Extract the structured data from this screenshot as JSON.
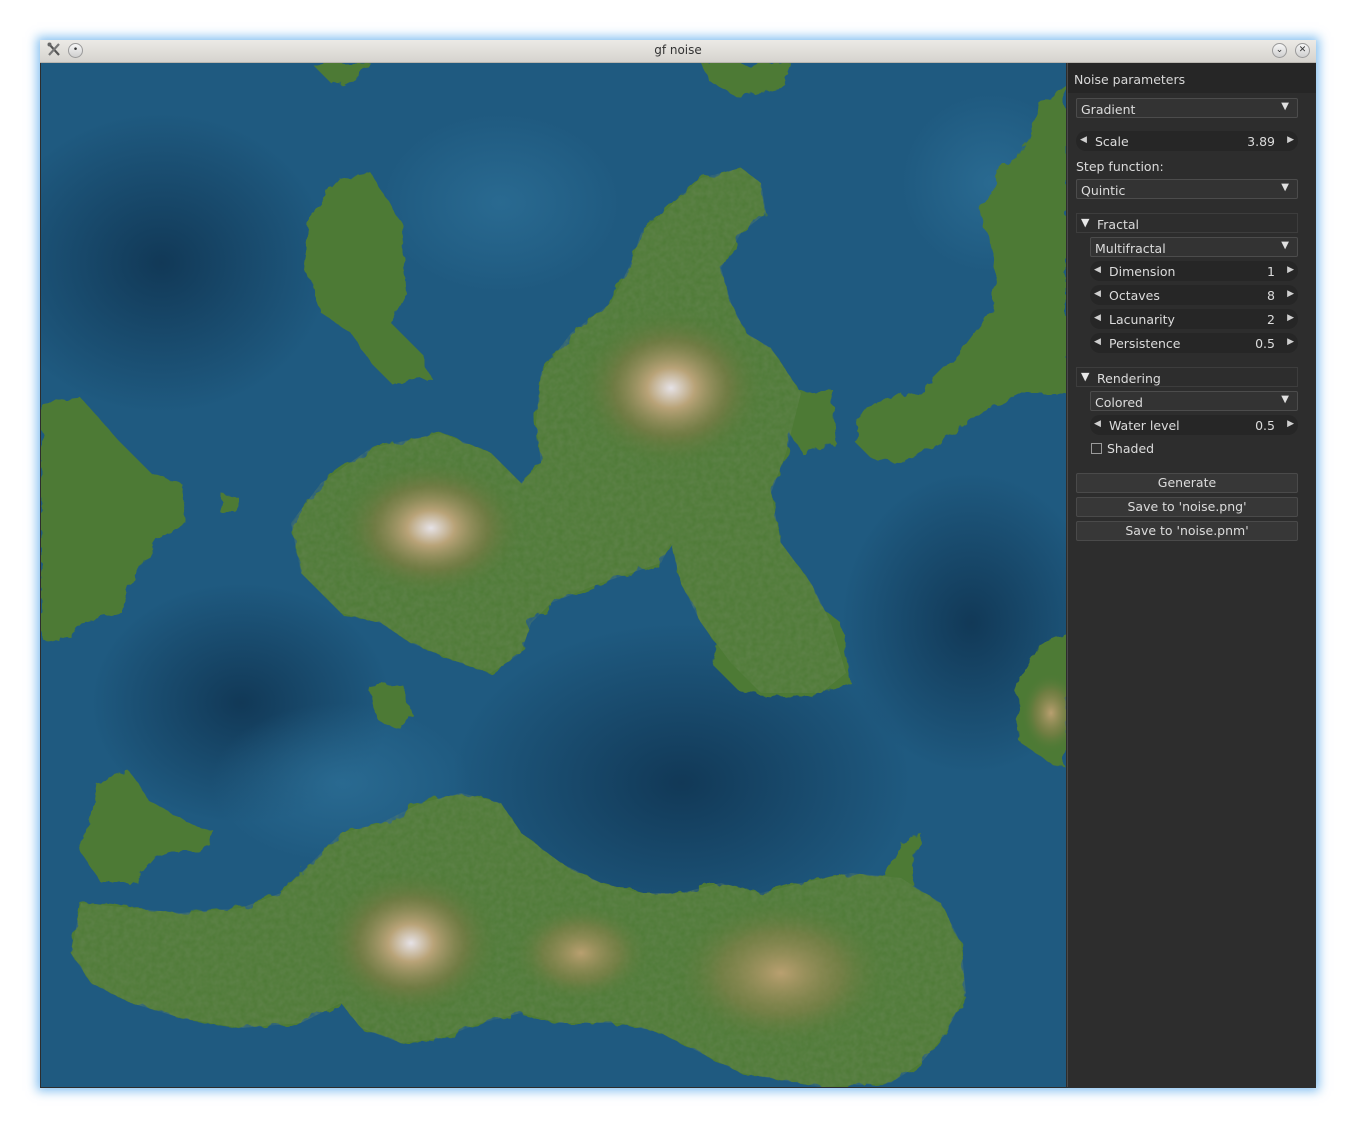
{
  "window": {
    "title": "gf noise"
  },
  "panel": {
    "header": "Noise parameters",
    "noise_type": "Gradient",
    "scale": {
      "label": "Scale",
      "value": "3.89"
    },
    "step_label": "Step function:",
    "step_function": "Quintic",
    "fractal": {
      "title": "Fractal",
      "type": "Multifractal",
      "dimension": {
        "label": "Dimension",
        "value": "1"
      },
      "octaves": {
        "label": "Octaves",
        "value": "8"
      },
      "lacunarity": {
        "label": "Lacunarity",
        "value": "2"
      },
      "persistence": {
        "label": "Persistence",
        "value": "0.5"
      }
    },
    "rendering": {
      "title": "Rendering",
      "mode": "Colored",
      "water_level": {
        "label": "Water level",
        "value": "0.5"
      },
      "shaded": {
        "label": "Shaded",
        "checked": false
      }
    },
    "buttons": {
      "generate": "Generate",
      "save_png": "Save to 'noise.png'",
      "save_pnm": "Save to 'noise.pnm'"
    }
  },
  "icons": {
    "dropdown": "▼",
    "left": "◀",
    "right": "▶",
    "expanded": "▼"
  },
  "colors": {
    "water_deep": "#123a58",
    "water": "#1f5a80",
    "land": "#4d7a35",
    "highland": "#b8a06a",
    "peak": "#e8e8ee",
    "panel_bg": "#2d2d2d"
  }
}
